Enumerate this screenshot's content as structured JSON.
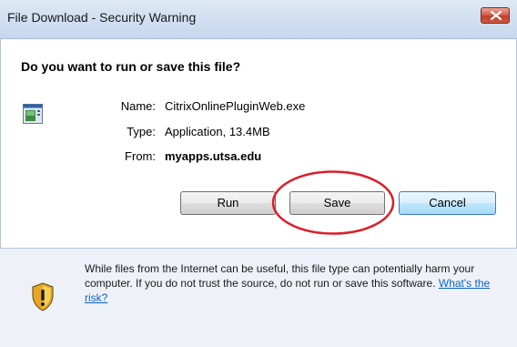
{
  "window": {
    "title": "File Download - Security Warning"
  },
  "dialog": {
    "question": "Do you want to run or save this file?",
    "file": {
      "name_label": "Name:",
      "name_value": "CitrixOnlinePluginWeb.exe",
      "type_label": "Type:",
      "type_value": "Application, 13.4MB",
      "from_label": "From:",
      "from_value": "myapps.utsa.edu"
    },
    "buttons": {
      "run": "Run",
      "save": "Save",
      "cancel": "Cancel"
    },
    "warning": {
      "text": "While files from the Internet can be useful, this file type can potentially harm your computer. If you do not trust the source, do not run or save this software. ",
      "link": "What's the risk?"
    }
  },
  "annotation": {
    "color": "#d8202a",
    "highlights": "save-button"
  },
  "colors": {
    "link": "#0a64c8",
    "close_button": "#c0402b",
    "default_button_border": "#3c7fb1"
  }
}
